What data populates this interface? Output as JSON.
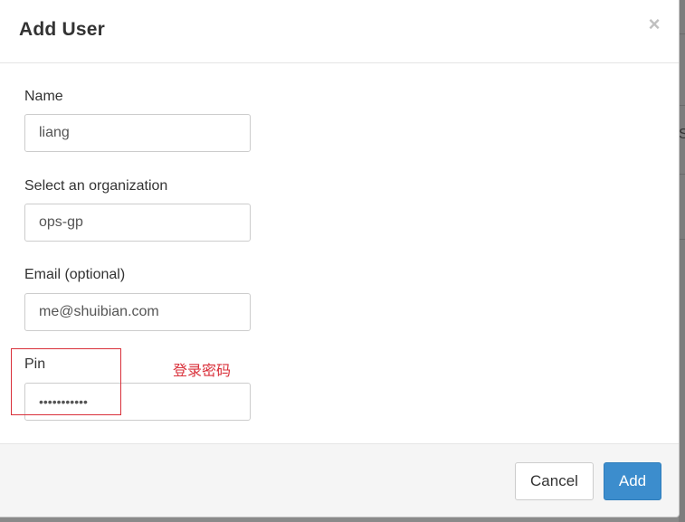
{
  "dialog": {
    "title": "Add User",
    "close_glyph": "×"
  },
  "backdrop": {
    "partial_char": "S"
  },
  "form": {
    "name": {
      "label": "Name",
      "value": "liang"
    },
    "organization": {
      "label": "Select an organization",
      "value": "ops-gp"
    },
    "email": {
      "label": "Email (optional)",
      "value": "me@shuibian.com"
    },
    "pin": {
      "label": "Pin",
      "value": "•••••••••••"
    }
  },
  "annotation": {
    "text": "登录密码",
    "color": "#d9303a"
  },
  "footer": {
    "cancel_label": "Cancel",
    "add_label": "Add"
  },
  "colors": {
    "primary": "#3c8dcd",
    "annotation": "#d9303a"
  }
}
